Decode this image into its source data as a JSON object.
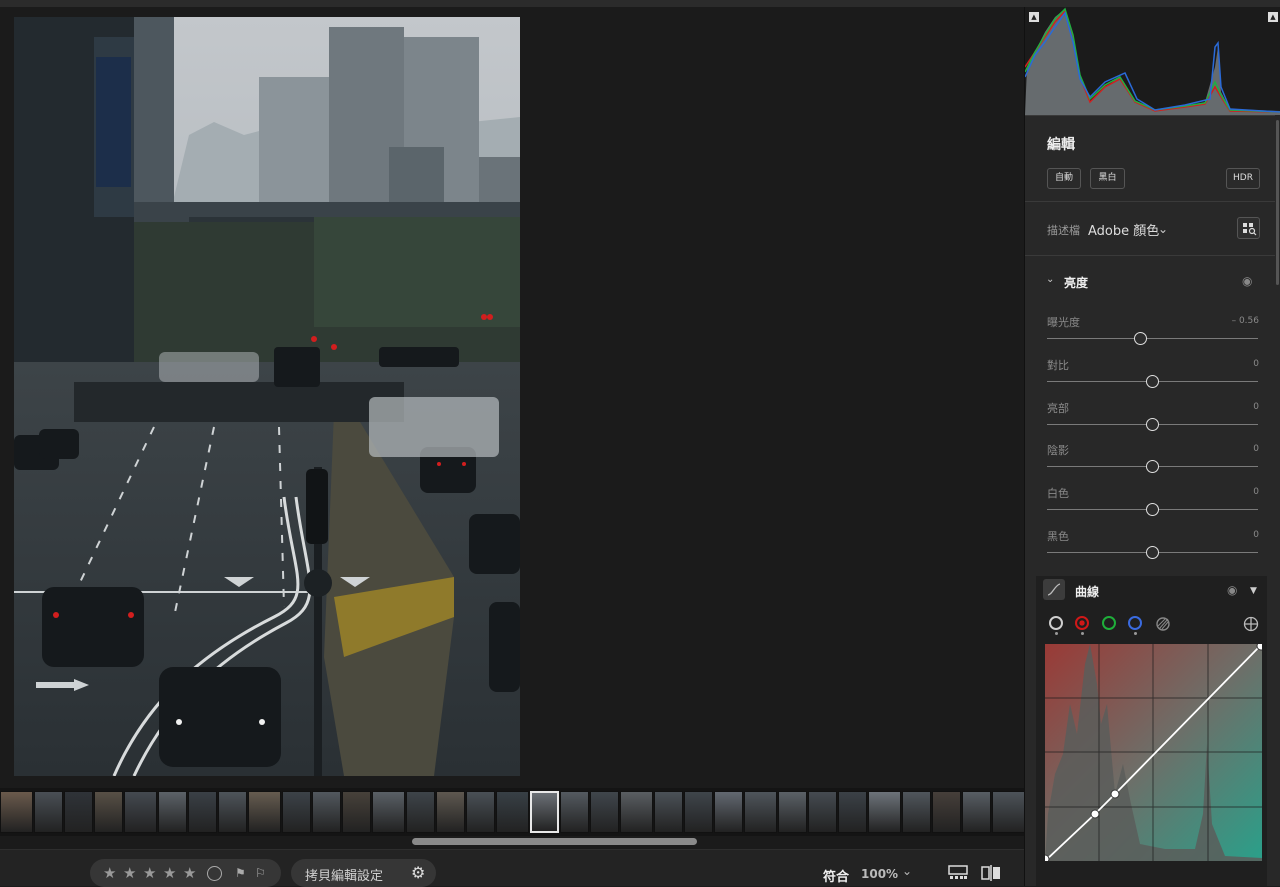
{
  "bottom_bar": {
    "copy_settings_label": "拷貝編輯設定",
    "fit_label": "符合",
    "zoom_label": "100%"
  },
  "edit_panel": {
    "title": "編輯",
    "auto_button": "自動",
    "bw_button": "黑白",
    "hdr_button": "HDR",
    "profile_label": "描述檔",
    "profile_value": "Adobe 顏色"
  },
  "light_section": {
    "title": "亮度",
    "sliders": [
      {
        "label": "曝光度",
        "value": "– 0.56",
        "level": -0.112
      },
      {
        "label": "對比",
        "value": "0",
        "level": 0
      },
      {
        "label": "亮部",
        "value": "0",
        "level": 0
      },
      {
        "label": "陰影",
        "value": "0",
        "level": 0
      },
      {
        "label": "白色",
        "value": "0",
        "level": 0
      },
      {
        "label": "黑色",
        "value": "0",
        "level": 0
      }
    ]
  },
  "curve_section": {
    "title": "曲線",
    "channels": [
      "white",
      "red",
      "green",
      "blue",
      "saturation"
    ],
    "colors": {
      "white": "#cfcfcf",
      "red": "#d01818",
      "green": "#1fae3a",
      "blue": "#3a6be0"
    }
  },
  "icons": {
    "curve": "curve-icon",
    "eye": "eye-icon",
    "gear": "gear-icon",
    "target": "target-adjust-icon"
  }
}
